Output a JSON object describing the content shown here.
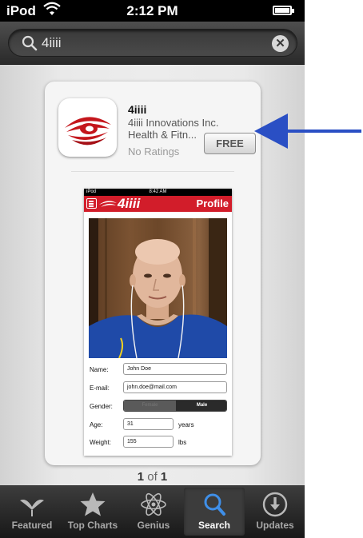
{
  "status_bar": {
    "carrier": "iPod",
    "time": "2:12 PM"
  },
  "search": {
    "query": "4iiii"
  },
  "app": {
    "name": "4iiii",
    "developer": "4iiii Innovations Inc.",
    "category": "Health & Fitn...",
    "rating": "No Ratings",
    "price_label": "FREE"
  },
  "preview": {
    "status_carrier": "iPod",
    "status_time": "8:42 AM",
    "brand": "4iiii",
    "header_title": "Profile",
    "form": {
      "name_label": "Name:",
      "name_value": "John Doe",
      "email_label": "E-mail:",
      "email_value": "john.doe@mail.com",
      "gender_label": "Gender:",
      "gender_female": "Female",
      "gender_male": "Male",
      "gender_selected": "Male",
      "age_label": "Age:",
      "age_value": "31",
      "age_unit": "years",
      "weight_label": "Weight:",
      "weight_value": "155",
      "weight_unit": "lbs"
    }
  },
  "pagination": {
    "current": "1",
    "separator": "of",
    "total": "1"
  },
  "tabs": [
    {
      "label": "Featured",
      "icon": "featured-icon"
    },
    {
      "label": "Top Charts",
      "icon": "star-icon"
    },
    {
      "label": "Genius",
      "icon": "atom-icon"
    },
    {
      "label": "Search",
      "icon": "search-icon",
      "active": true
    },
    {
      "label": "Updates",
      "icon": "download-icon"
    }
  ],
  "colors": {
    "brand_red": "#d21d2a",
    "arrow_blue": "#2a4fc4",
    "tab_active": "#3f8fe8"
  }
}
